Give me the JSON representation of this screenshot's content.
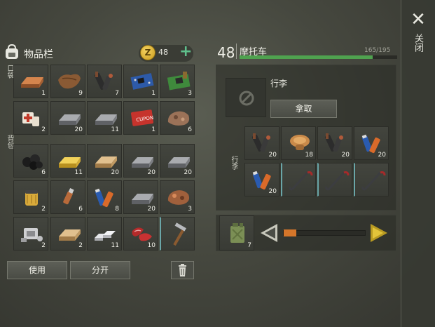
{
  "close_label": "关闭",
  "close_glyph": "✕",
  "inventory": {
    "title": "物品栏",
    "coin_symbol": "Z",
    "coins": "48",
    "add_glyph": "+",
    "pocket_label": "口袋",
    "backpack_label": "背包",
    "pocket_items": [
      {
        "icon": "copper-ingot-icon",
        "count": "1"
      },
      {
        "icon": "leather-icon",
        "count": "9"
      },
      {
        "icon": "flashlight-icon",
        "count": "7"
      },
      {
        "icon": "circuit-board-blue-icon",
        "count": "1"
      },
      {
        "icon": "circuit-board-green-icon",
        "count": "3"
      },
      {
        "icon": "first-aid-kit-icon",
        "count": "2"
      },
      {
        "icon": "iron-ingot-icon",
        "count": "20"
      },
      {
        "icon": "iron-ingot-icon",
        "count": "11"
      },
      {
        "icon": "coupon-ticket-icon",
        "count": "1"
      },
      {
        "icon": "ore-rock-icon",
        "count": "6"
      }
    ],
    "backpack_items": [
      {
        "icon": "coal-icon",
        "count": "6"
      },
      {
        "icon": "gold-ingot-icon",
        "count": "11"
      },
      {
        "icon": "wood-plank-icon",
        "count": "20"
      },
      {
        "icon": "iron-ingot-icon",
        "count": "20"
      },
      {
        "icon": "iron-ingot-icon",
        "count": "20"
      },
      {
        "icon": "oil-filter-icon",
        "count": "2"
      },
      {
        "icon": "usb-stick-icon",
        "count": "6"
      },
      {
        "icon": "batteries-icon",
        "count": "8"
      },
      {
        "icon": "iron-ingot-icon",
        "count": "20"
      },
      {
        "icon": "copper-ore-icon",
        "count": "3"
      },
      {
        "icon": "engine-part-icon",
        "count": "2"
      },
      {
        "icon": "wood-plank-icon",
        "count": "2"
      },
      {
        "icon": "aluminum-bars-icon",
        "count": "11"
      },
      {
        "icon": "raw-meat-icon",
        "count": "10"
      },
      {
        "icon": "hammer-icon",
        "count": ""
      }
    ],
    "use_label": "使用",
    "split_label": "分开"
  },
  "vehicle": {
    "level": "48",
    "name": "摩托车",
    "durability_text": "165/195",
    "durability": 0.846,
    "luggage_label": "行李",
    "take_label": "拿取",
    "cargo_label": "行李",
    "cargo_items": [
      {
        "icon": "flashlight-icon",
        "count": "20"
      },
      {
        "icon": "mushroom-bundle-icon",
        "count": "18"
      },
      {
        "icon": "flashlight-icon",
        "count": "20"
      },
      {
        "icon": "batteries-icon",
        "count": "20"
      },
      {
        "icon": "batteries-icon",
        "count": "20"
      },
      {
        "icon": "crowbar-icon",
        "count": ""
      },
      {
        "icon": "crowbar-icon",
        "count": ""
      },
      {
        "icon": "crowbar-icon",
        "count": ""
      }
    ],
    "fuel_icon": "jerry-can-icon",
    "fuel_count": "7",
    "fuel_amount": 0.0
  }
}
